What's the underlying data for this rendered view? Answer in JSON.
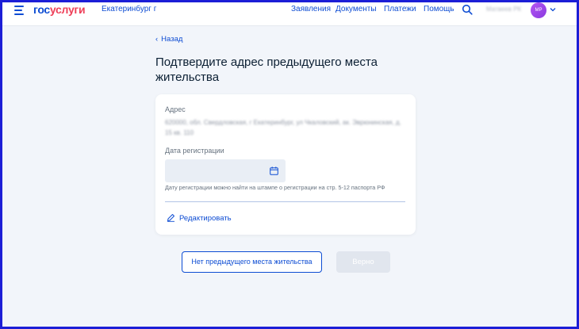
{
  "header": {
    "logo_part1": "гос",
    "logo_part2": "услуги",
    "city": "Екатеринбург г",
    "nav": [
      "Заявления",
      "Документы",
      "Платежи",
      "Помощь"
    ],
    "user_name": "Матвеев РК",
    "avatar_initials": "МР"
  },
  "page": {
    "back_label": "Назад",
    "title": "Подтвердите адрес предыдущего места жительства"
  },
  "card": {
    "address_label": "Адрес",
    "address_value": "620000, обл. Свердловская, г Екатеринбург, ул Чкаловский, ак. Эврюнинская, д. 15 кв. 110",
    "date_label": "Дата регистрации",
    "date_value": "",
    "hint": "Дату регистрации можно найти на штампе о регистрации на стр. 5-12 паспорта РФ",
    "edit_label": "Редактировать"
  },
  "actions": {
    "no_previous_label": "Нет предыдущего места жительства",
    "confirm_label": "Верно"
  },
  "colors": {
    "accent": "#0d4cd3",
    "logo_red": "#ee3f58",
    "background": "#f2f5fa",
    "frame": "#1c1ed6"
  }
}
